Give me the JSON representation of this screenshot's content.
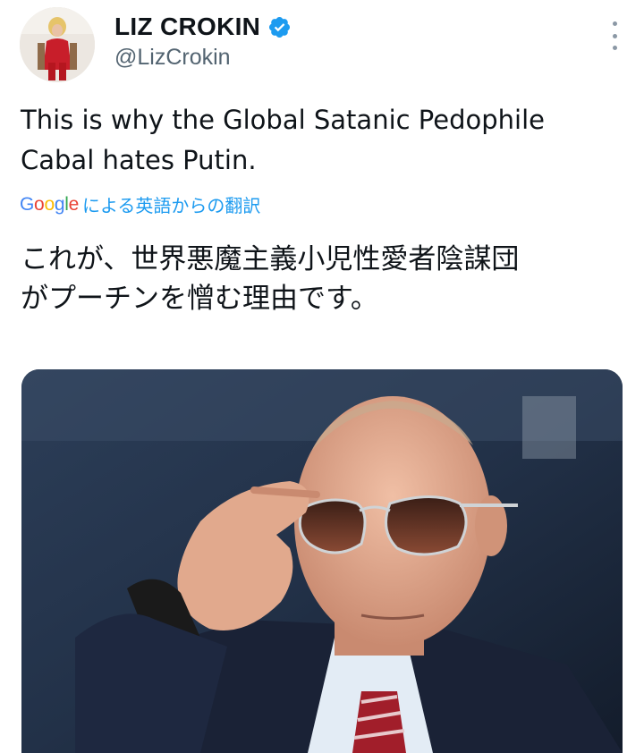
{
  "tweet": {
    "author_name": "LIZ CROKIN",
    "handle": "@LizCrokin",
    "text_line1": "This is why the Global Satanic Pedophile",
    "text_line2": "Cabal hates Putin.",
    "translation": {
      "google_letters": [
        "G",
        "o",
        "o",
        "g",
        "l",
        "e"
      ],
      "label": "による英語からの翻訳",
      "text_line1": "これが、世界悪魔主義小児性愛者陰謀団",
      "text_line2": "がプーチンを憎む理由です。"
    }
  },
  "colors": {
    "verified": "#1d9bf0",
    "link": "#1d9bf0",
    "handle": "#536471"
  }
}
